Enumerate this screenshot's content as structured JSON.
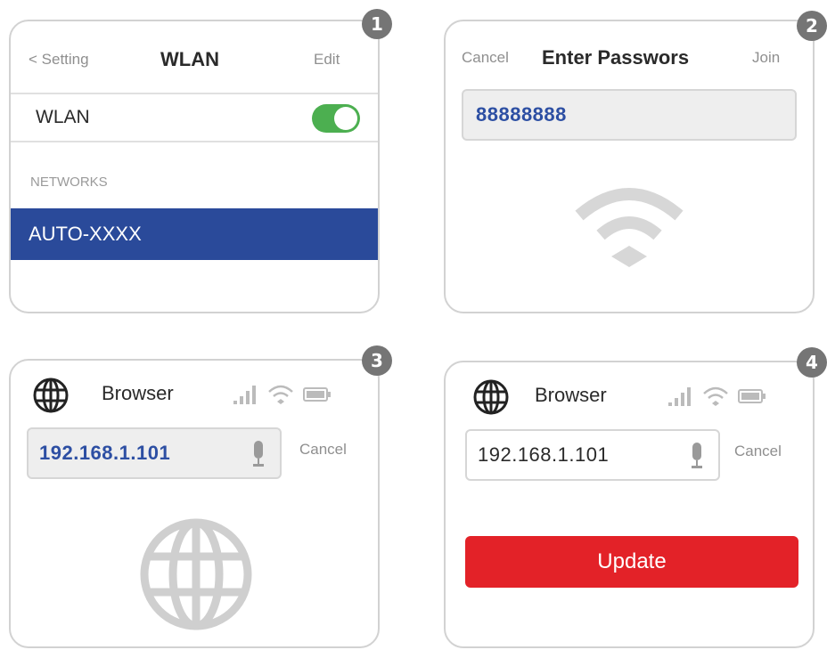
{
  "panels": [
    {
      "badge": "1",
      "nav_back": "< Setting",
      "title": "WLAN",
      "nav_action": "Edit",
      "toggle_label": "WLAN",
      "toggle_on": true,
      "section_label": "NETWORKS",
      "selected_network": "AUTO-XXXX"
    },
    {
      "badge": "2",
      "nav_back": "Cancel",
      "title": "Enter Passwors",
      "nav_action": "Join",
      "password_value": "88888888",
      "icon": "wifi-icon"
    },
    {
      "badge": "3",
      "title": "Browser",
      "url_value": "192.168.1.101",
      "cancel_label": "Cancel",
      "icon": "globe-icon"
    },
    {
      "badge": "4",
      "title": "Browser",
      "url_value": "192.168.1.101",
      "cancel_label": "Cancel",
      "button_label": "Update"
    }
  ],
  "colors": {
    "selection": "#2a4a9a",
    "toggle_on": "#4caf50",
    "update_button": "#e32228",
    "input_text_blue": "#2d4fa3",
    "badge": "#757575"
  }
}
